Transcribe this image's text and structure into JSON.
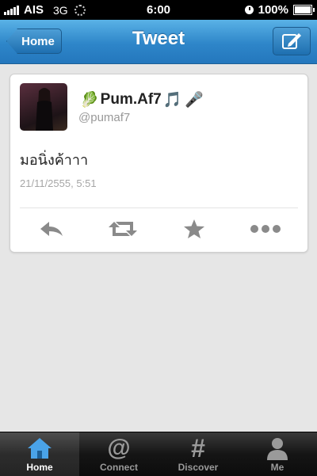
{
  "status_bar": {
    "carrier": "AIS",
    "network": "3G",
    "time": "6:00",
    "battery": "100%"
  },
  "nav": {
    "back_label": "Home",
    "title": "Tweet",
    "compose_icon": "compose-icon"
  },
  "tweet": {
    "display_name": "Pum.Af7",
    "name_emoji": {
      "leading": "🥬",
      "music": "🎵",
      "mic": "🎤"
    },
    "username": "@pumaf7",
    "text": "มอนิ่งค้าาา",
    "timestamp": "21/11/2555, 5:51",
    "actions": [
      "reply-icon",
      "retweet-icon",
      "favorite-icon",
      "more-icon"
    ]
  },
  "tabs": [
    {
      "label": "Home",
      "icon": "home-icon",
      "active": true
    },
    {
      "label": "Connect",
      "icon": "at-icon",
      "active": false
    },
    {
      "label": "Discover",
      "icon": "hash-icon",
      "active": false
    },
    {
      "label": "Me",
      "icon": "person-icon",
      "active": false
    }
  ],
  "colors": {
    "nav_blue": "#2e86c9",
    "active_tab_icon": "#4aa3e8",
    "action_gray": "#8a8a8a"
  }
}
